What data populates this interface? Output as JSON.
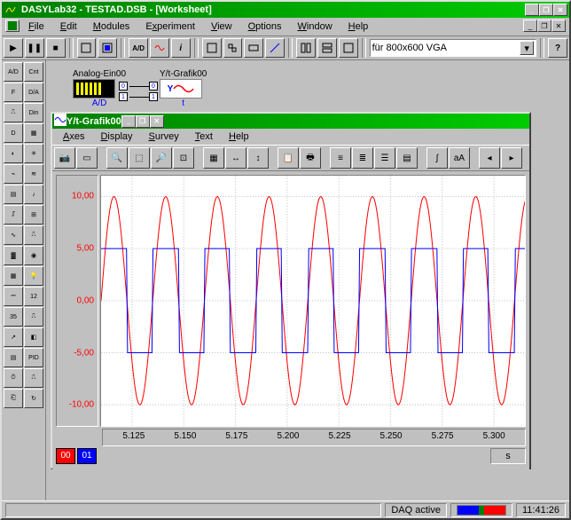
{
  "window": {
    "title": "DASYLab32 - TESTAD.DSB - [Worksheet]",
    "min": "_",
    "max": "❐",
    "close": "✕"
  },
  "menu": {
    "file": "File",
    "edit": "Edit",
    "modules": "Modules",
    "experiment": "Experiment",
    "view": "View",
    "options": "Options",
    "window": "Window",
    "help": "Help"
  },
  "toolbar": {
    "dropdown_value": "für 800x600 VGA",
    "play": "▶",
    "pause": "❚❚",
    "stop": "■",
    "help": "?"
  },
  "blocks": {
    "adc": {
      "title": "Analog-Ein00",
      "label": "A/D"
    },
    "chart": {
      "title": "Y/t-Grafik00",
      "label": "Y",
      "sublabel": "t"
    }
  },
  "chart_window": {
    "title": "Y/t-Grafik00",
    "menu": {
      "axes": "Axes",
      "display": "Display",
      "survey": "Survey",
      "text": "Text",
      "help": "Help"
    },
    "legend": [
      "00",
      "01"
    ],
    "unit": "s"
  },
  "chart_data": {
    "type": "line",
    "title": "",
    "xlabel": "",
    "ylabel": "",
    "xlim": [
      5.11,
      5.315
    ],
    "ylim": [
      -12,
      12
    ],
    "y_ticks": [
      "10,00",
      "5,00",
      "0,00",
      "-5,00",
      "-10,00"
    ],
    "y_tick_values": [
      10,
      5,
      0,
      -5,
      -10
    ],
    "x_ticks": [
      "5.125",
      "5.150",
      "5.175",
      "5.200",
      "5.225",
      "5.250",
      "5.275",
      "5.300"
    ],
    "x_tick_values": [
      5.125,
      5.15,
      5.175,
      5.2,
      5.225,
      5.25,
      5.275,
      5.3
    ],
    "series": [
      {
        "name": "00",
        "color": "#ff0000",
        "type": "sine",
        "amplitude": 10,
        "period": 0.025,
        "phase": 5.11
      },
      {
        "name": "01",
        "color": "#0000ff",
        "type": "square",
        "amplitude": 5,
        "period": 0.025,
        "phase": 5.11
      }
    ]
  },
  "status": {
    "daq": "DAQ active",
    "time": "11:41:26"
  }
}
